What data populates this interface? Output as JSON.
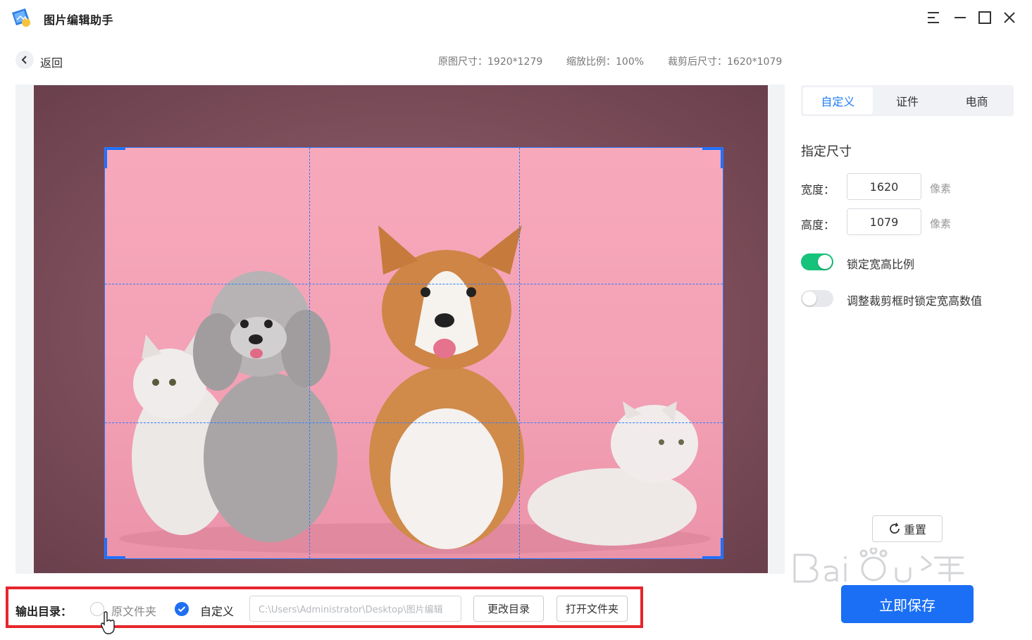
{
  "app": {
    "title": "图片编辑助手",
    "logo_icon": "app-logo-icon"
  },
  "window_controls": {
    "menu_icon": "menu-icon",
    "minimize_icon": "minimize-icon",
    "maximize_icon": "maximize-icon",
    "close_icon": "close-icon"
  },
  "nav": {
    "back_label": "返回"
  },
  "info": {
    "original_size": "原图尺寸：1920*1279",
    "zoom": "缩放比例：100%",
    "cropped_size": "裁剪后尺寸：1620*1079"
  },
  "panel": {
    "tabs": [
      {
        "label": "自定义",
        "active": true
      },
      {
        "label": "证件",
        "active": false
      },
      {
        "label": "电商",
        "active": false
      }
    ],
    "section_title": "指定尺寸",
    "width_label": "宽度：",
    "width_value": "1620",
    "height_label": "高度：",
    "height_value": "1079",
    "unit": "像素",
    "lock_ratio": {
      "label": "锁定宽高比例",
      "on": true
    },
    "lock_values": {
      "label": "调整裁剪框时锁定宽高数值",
      "on": false
    },
    "reset_label": "重置",
    "save_label": "立即保存"
  },
  "output": {
    "label": "输出目录：",
    "option_original": "原文件夹",
    "option_custom": "自定义",
    "path_value": "C:\\Users\\Administrator\\Desktop\\图片编辑",
    "change_dir_label": "更改目录",
    "open_folder_label": "打开文件夹"
  },
  "colors": {
    "accent": "#1f7cf5",
    "toggle_on": "#17c27a",
    "highlight_box": "#e5262c",
    "crop_border": "#2e7bff"
  }
}
